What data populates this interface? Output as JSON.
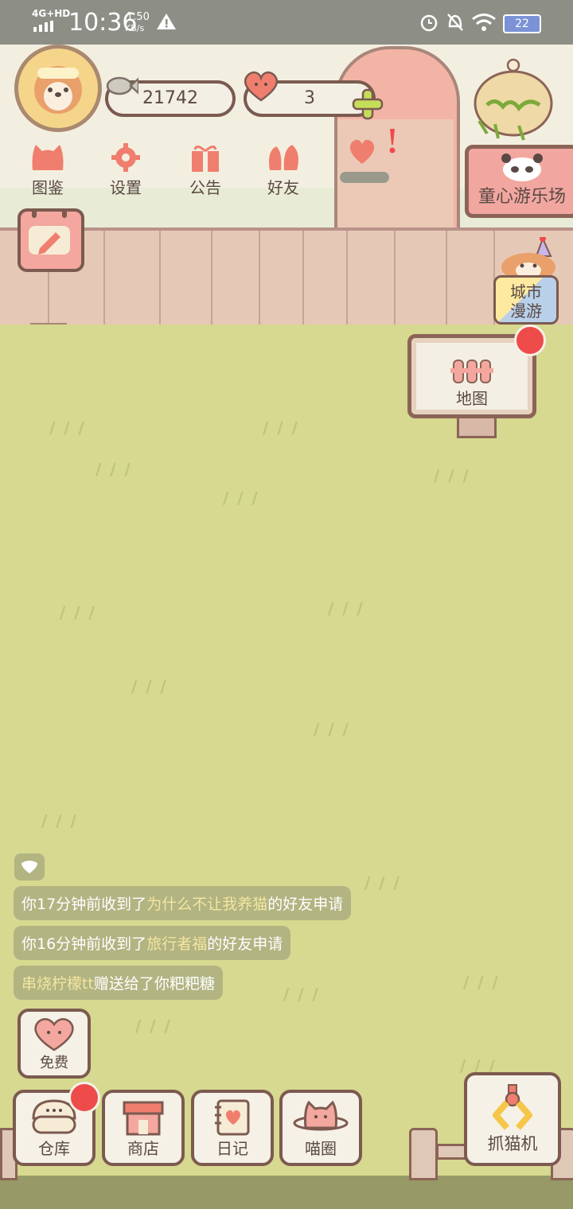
{
  "status_bar": {
    "network": "4G+HD",
    "time": "10:36",
    "speed_value": "1.50",
    "speed_unit": "KB/s",
    "battery": "22"
  },
  "header": {
    "fish_count": "21742",
    "heart_count": "3"
  },
  "menu": [
    {
      "label": "图鉴",
      "icon": "cat-head-icon"
    },
    {
      "label": "设置",
      "icon": "gear-icon"
    },
    {
      "label": "公告",
      "icon": "gift-icon"
    },
    {
      "label": "好友",
      "icon": "friends-icon"
    }
  ],
  "right_buttons": {
    "amusement_park": "童心游乐场",
    "city_tour_line1": "城市",
    "city_tour_line2": "漫游",
    "map": "地图"
  },
  "messages": [
    {
      "prefix": "你17分钟前收到了",
      "name": "为什么不让我养猫",
      "suffix": "的好友申请"
    },
    {
      "prefix": "你16分钟前收到了",
      "name": "旅行者福",
      "suffix": "的好友申请"
    },
    {
      "prefix": "",
      "name": "串烧柠檬tt",
      "suffix": "赠送给了你粑粑糖"
    }
  ],
  "bottom": {
    "free": "免费",
    "warehouse": "仓库",
    "shop": "商店",
    "diary": "日记",
    "meow_circle": "喵圈",
    "claw_machine": "抓猫机"
  },
  "colors": {
    "grass": "#d6d98f",
    "accent": "#f07e6e",
    "notification": "#ee4b4b",
    "border": "#7c5a50"
  }
}
